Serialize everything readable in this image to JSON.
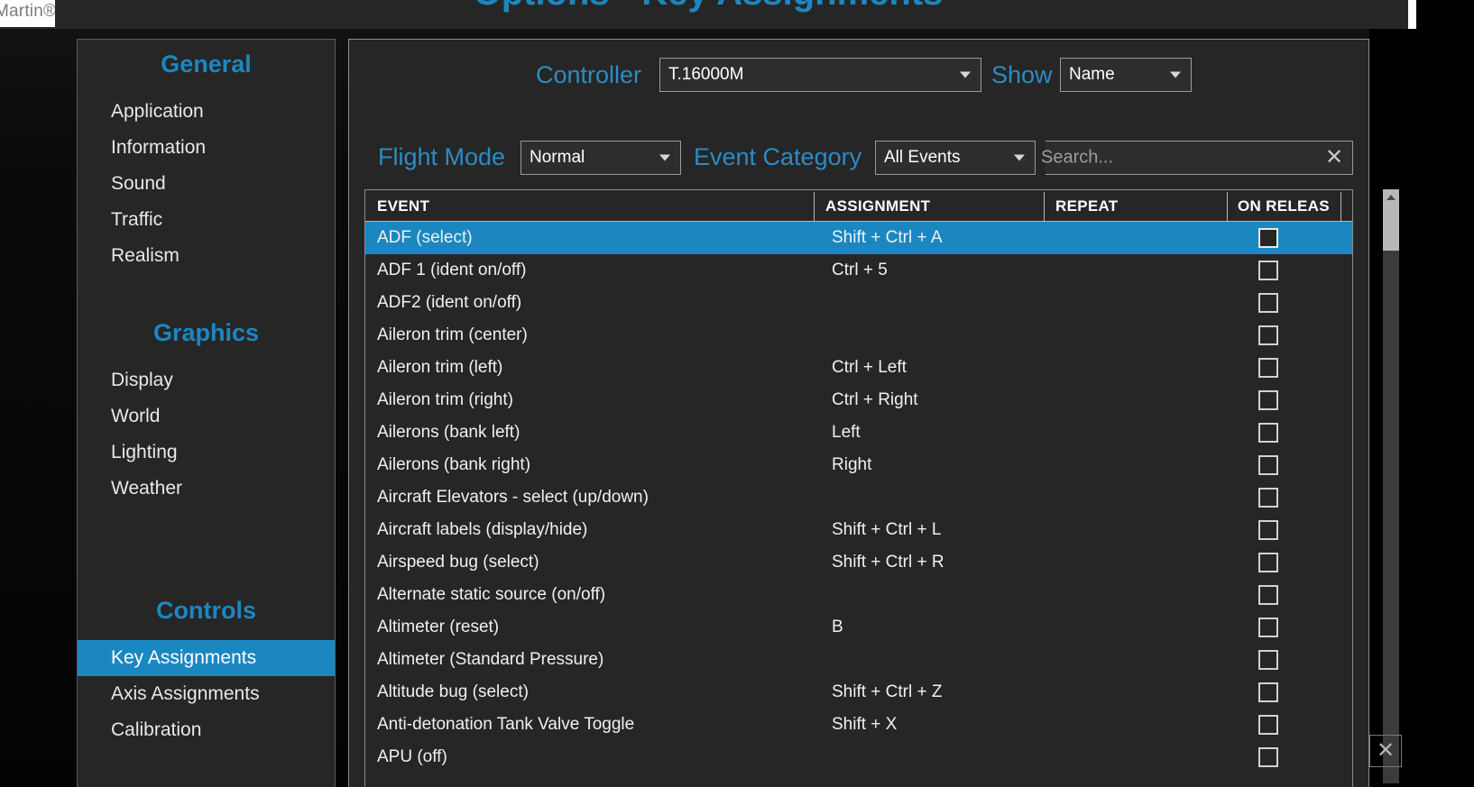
{
  "window": {
    "title": "Options - Key Assignments",
    "watermark": "Martin®",
    "minimize_label": "—",
    "close_label": "✕",
    "accent_color": "#1b87c1",
    "panel_bg": "#262626"
  },
  "sidebar": {
    "sections": [
      {
        "heading": "General",
        "items": [
          {
            "label": "Application",
            "active": false
          },
          {
            "label": "Information",
            "active": false
          },
          {
            "label": "Sound",
            "active": false
          },
          {
            "label": "Traffic",
            "active": false
          },
          {
            "label": "Realism",
            "active": false
          }
        ]
      },
      {
        "heading": "Graphics",
        "items": [
          {
            "label": "Display",
            "active": false
          },
          {
            "label": "World",
            "active": false
          },
          {
            "label": "Lighting",
            "active": false
          },
          {
            "label": "Weather",
            "active": false
          }
        ]
      },
      {
        "heading": "Controls",
        "items": [
          {
            "label": "Key Assignments",
            "active": true
          },
          {
            "label": "Axis Assignments",
            "active": false
          },
          {
            "label": "Calibration",
            "active": false
          }
        ]
      }
    ]
  },
  "toolbar": {
    "controller_label": "Controller",
    "controller_value": "T.16000M",
    "show_label": "Show",
    "show_value": "Name",
    "flight_mode_label": "Flight Mode",
    "flight_mode_value": "Normal",
    "event_category_label": "Event Category",
    "event_category_value": "All Events",
    "search_placeholder": "Search...",
    "search_value": "",
    "search_clear_icon": "✕"
  },
  "table": {
    "columns": [
      "EVENT",
      "ASSIGNMENT",
      "REPEAT",
      "ON RELEAS"
    ],
    "rows": [
      {
        "event": "ADF (select)",
        "assignment": "Shift + Ctrl + A",
        "repeat": "",
        "on_release": false,
        "selected": true
      },
      {
        "event": "ADF 1 (ident on/off)",
        "assignment": "Ctrl + 5",
        "repeat": "",
        "on_release": false,
        "selected": false
      },
      {
        "event": "ADF2 (ident on/off)",
        "assignment": "",
        "repeat": "",
        "on_release": false,
        "selected": false
      },
      {
        "event": "Aileron trim (center)",
        "assignment": "",
        "repeat": "",
        "on_release": false,
        "selected": false
      },
      {
        "event": "Aileron trim (left)",
        "assignment": "Ctrl + Left",
        "repeat": "",
        "on_release": false,
        "selected": false
      },
      {
        "event": "Aileron trim (right)",
        "assignment": "Ctrl + Right",
        "repeat": "",
        "on_release": false,
        "selected": false
      },
      {
        "event": "Ailerons (bank left)",
        "assignment": "Left",
        "repeat": "",
        "on_release": false,
        "selected": false
      },
      {
        "event": "Ailerons (bank right)",
        "assignment": "Right",
        "repeat": "",
        "on_release": false,
        "selected": false
      },
      {
        "event": "Aircraft Elevators - select (up/down)",
        "assignment": "",
        "repeat": "",
        "on_release": false,
        "selected": false
      },
      {
        "event": "Aircraft labels (display/hide)",
        "assignment": "Shift + Ctrl + L",
        "repeat": "",
        "on_release": false,
        "selected": false
      },
      {
        "event": "Airspeed bug (select)",
        "assignment": "Shift + Ctrl + R",
        "repeat": "",
        "on_release": false,
        "selected": false
      },
      {
        "event": "Alternate static source (on/off)",
        "assignment": "",
        "repeat": "",
        "on_release": false,
        "selected": false
      },
      {
        "event": "Altimeter (reset)",
        "assignment": "B",
        "repeat": "",
        "on_release": false,
        "selected": false
      },
      {
        "event": "Altimeter (Standard Pressure)",
        "assignment": "",
        "repeat": "",
        "on_release": false,
        "selected": false
      },
      {
        "event": "Altitude bug (select)",
        "assignment": "Shift + Ctrl + Z",
        "repeat": "",
        "on_release": false,
        "selected": false
      },
      {
        "event": "Anti-detonation Tank Valve Toggle",
        "assignment": "Shift + X",
        "repeat": "",
        "on_release": false,
        "selected": false
      },
      {
        "event": "APU (off)",
        "assignment": "",
        "repeat": "",
        "on_release": false,
        "selected": false
      }
    ]
  },
  "scrollbar": {
    "up_arrow_icon": "▲",
    "position_percent": 0
  }
}
